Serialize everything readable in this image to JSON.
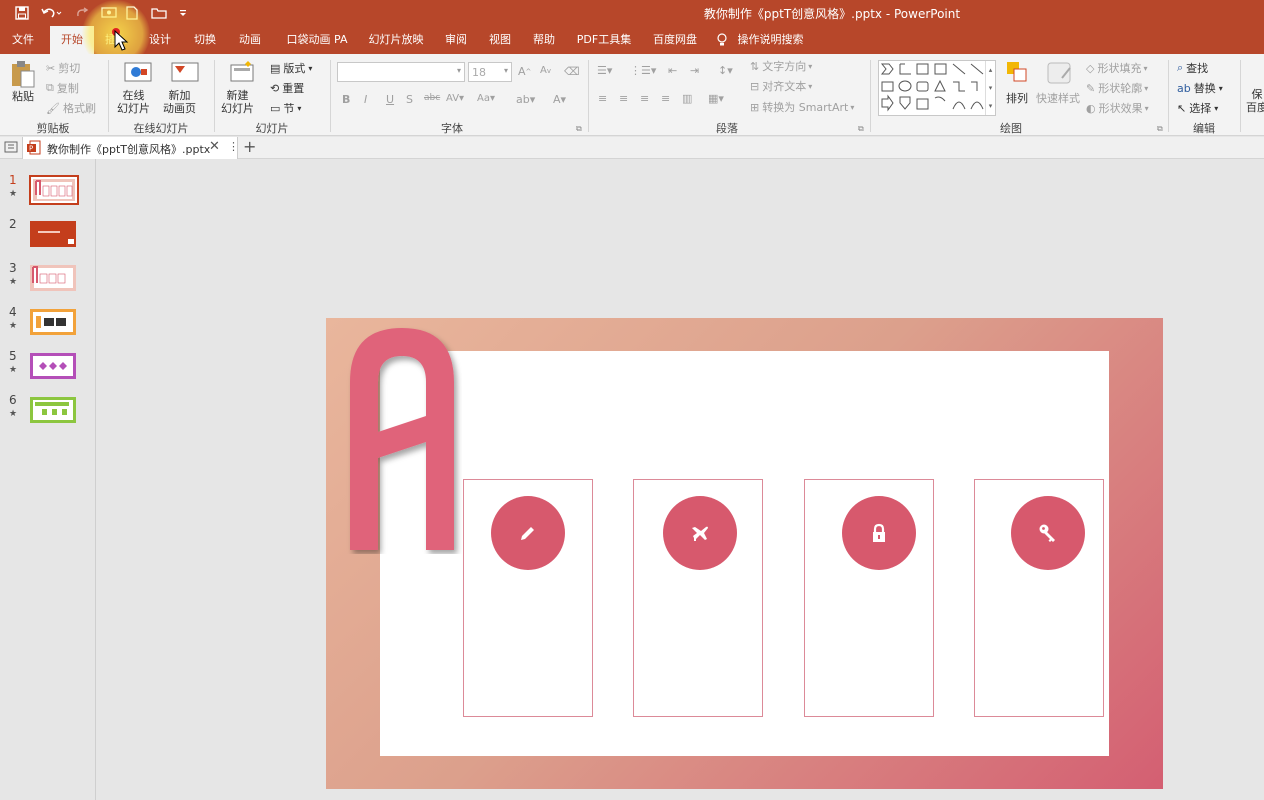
{
  "window": {
    "title": "教你制作《pptT创意风格》.pptx  -  PowerPoint"
  },
  "menu": {
    "tabs": [
      "文件",
      "开始",
      "插入",
      "设计",
      "切换",
      "动画",
      "口袋动画 PA",
      "幻灯片放映",
      "审阅",
      "视图",
      "帮助",
      "PDF工具集",
      "百度网盘"
    ],
    "active_index": 1,
    "search_label": "操作说明搜索"
  },
  "ribbon": {
    "clipboard": {
      "paste": "粘贴",
      "cut": "剪切",
      "copy": "复制",
      "format_painter": "格式刷",
      "label": "剪贴板"
    },
    "online_slides": {
      "online_line1": "在线",
      "online_line2": "幻灯片",
      "new_add_line1": "新加",
      "new_add_line2": "动画页",
      "label": "在线幻灯片"
    },
    "slides": {
      "new_line1": "新建",
      "new_line2": "幻灯片",
      "layout": "版式",
      "reset": "重置",
      "section": "节",
      "label": "幻灯片"
    },
    "font": {
      "size": "18",
      "label": "字体"
    },
    "paragraph": {
      "text_direction": "文字方向",
      "align_text": "对齐文本",
      "smartart": "转换为 SmartArt",
      "label": "段落"
    },
    "drawing": {
      "arrange": "排列",
      "quick_styles": "快速样式",
      "shape_fill": "形状填充",
      "shape_outline": "形状轮廓",
      "shape_effects": "形状效果",
      "label": "绘图"
    },
    "editing": {
      "find": "查找",
      "replace": "替换",
      "select": "选择",
      "label": "编辑"
    },
    "extra": {
      "line1": "保",
      "line2": "百度"
    }
  },
  "doc_tab": {
    "name": "教你制作《pptT创意风格》.pptx"
  },
  "thumbnails": [
    "1",
    "2",
    "3",
    "4",
    "5",
    "6"
  ],
  "slide": {
    "letter": "A",
    "icons": [
      "pencil-icon",
      "plane-icon",
      "lock-icon",
      "key-icon"
    ]
  },
  "colors": {
    "title_bar": "#b7472a",
    "slide_accent": "#d7596d",
    "card_border": "#dc8a98"
  }
}
